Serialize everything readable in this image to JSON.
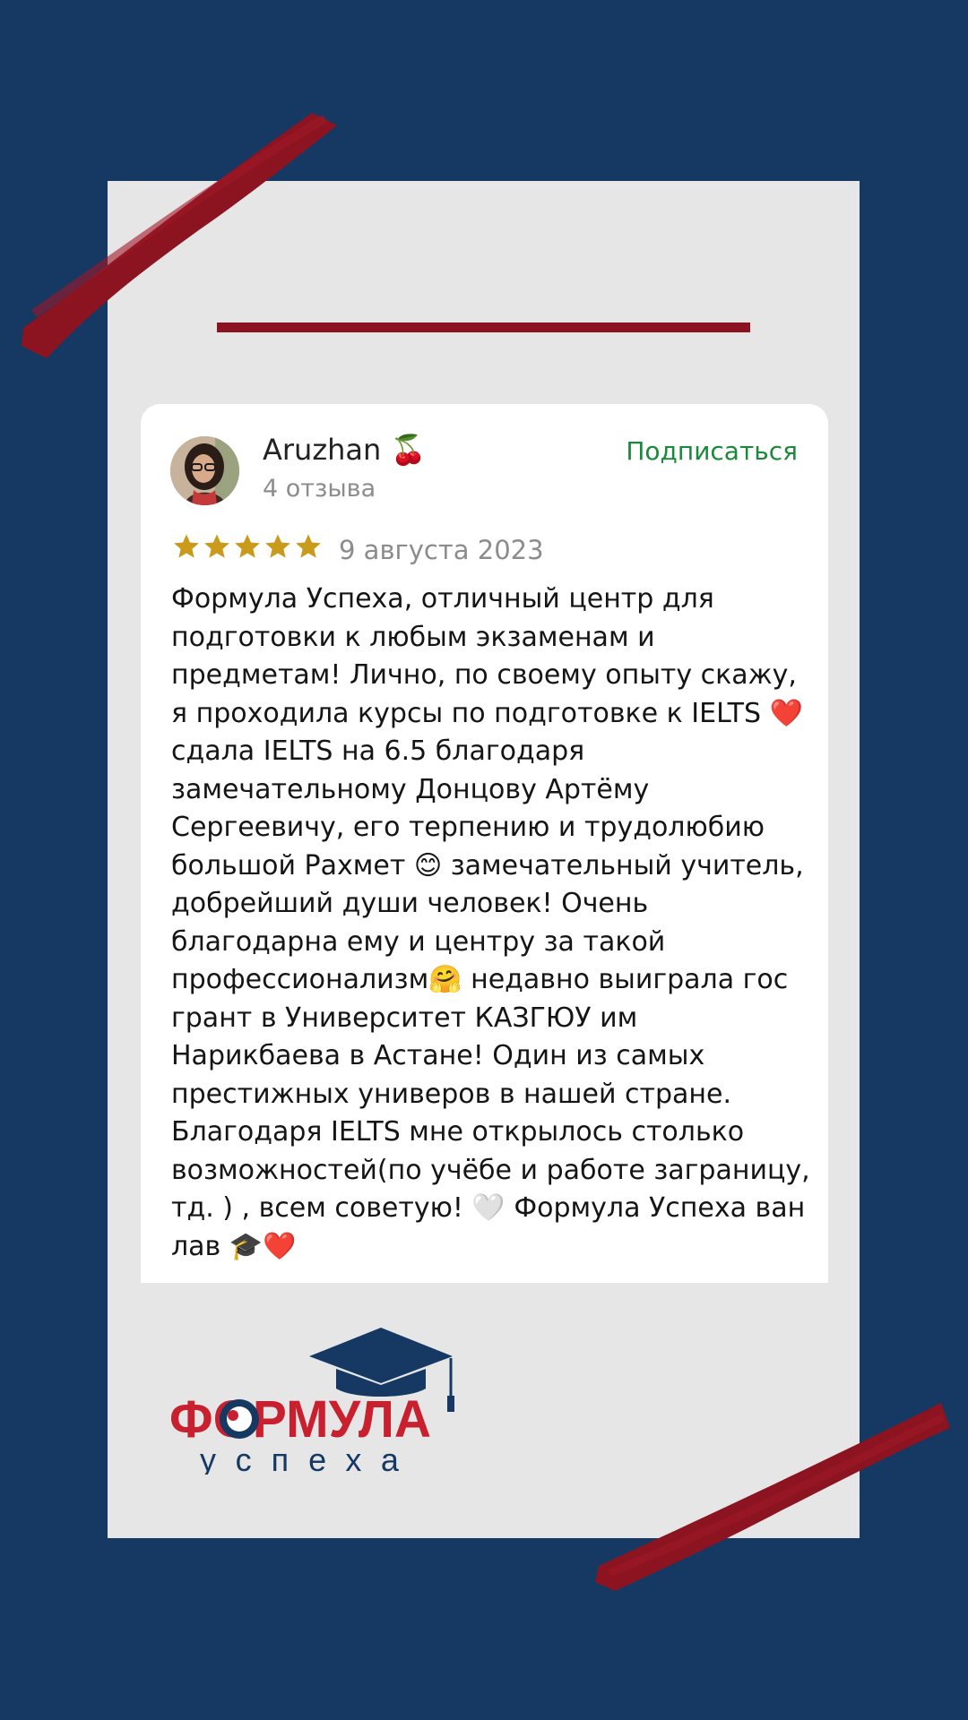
{
  "review": {
    "author": "Aruzhan 🍒",
    "review_count": "4 отзыва",
    "subscribe_label": "Подписаться",
    "rating": 5,
    "rating_max": 5,
    "date": "9 августа 2023",
    "text_lines": [
      "Формула Успеха, отличный центр для",
      "подготовки к любым экзаменам и",
      "предметам! Лично, по своему опыту скажу,",
      "я проходила курсы по подготовке к IELTS ❤️",
      "сдала IELTS на 6.5 благодаря",
      "замечательному Донцову Артёму",
      "Сергеевичу, его терпению и трудолюбию",
      "большой Рахмет 😊 замечательный учитель,",
      "добрейший души человек! Очень",
      "благодарна ему и центру за такой",
      "профессионализм🤗 недавно выиграла гос",
      "грант в Университет КАЗГЮУ им",
      "Нарикбаева в Астане! Один из самых",
      "престижных универов в нашей стране.",
      "Благодаря IELTS мне открылось столько",
      "возможностей(по учёбе и работе заграницу,",
      "тд. ) , всем советую! 🤍 Формула Успеха ван",
      "лав 🎓❤️"
    ]
  },
  "logo": {
    "line1": "ФОРМУЛА",
    "line2": "успеха"
  },
  "colors": {
    "background": "#153963",
    "frame": "#e7e6e6",
    "accent_red": "#8b1420",
    "subscribe_green": "#1a8a3a",
    "star_gold": "#c99a1c"
  }
}
